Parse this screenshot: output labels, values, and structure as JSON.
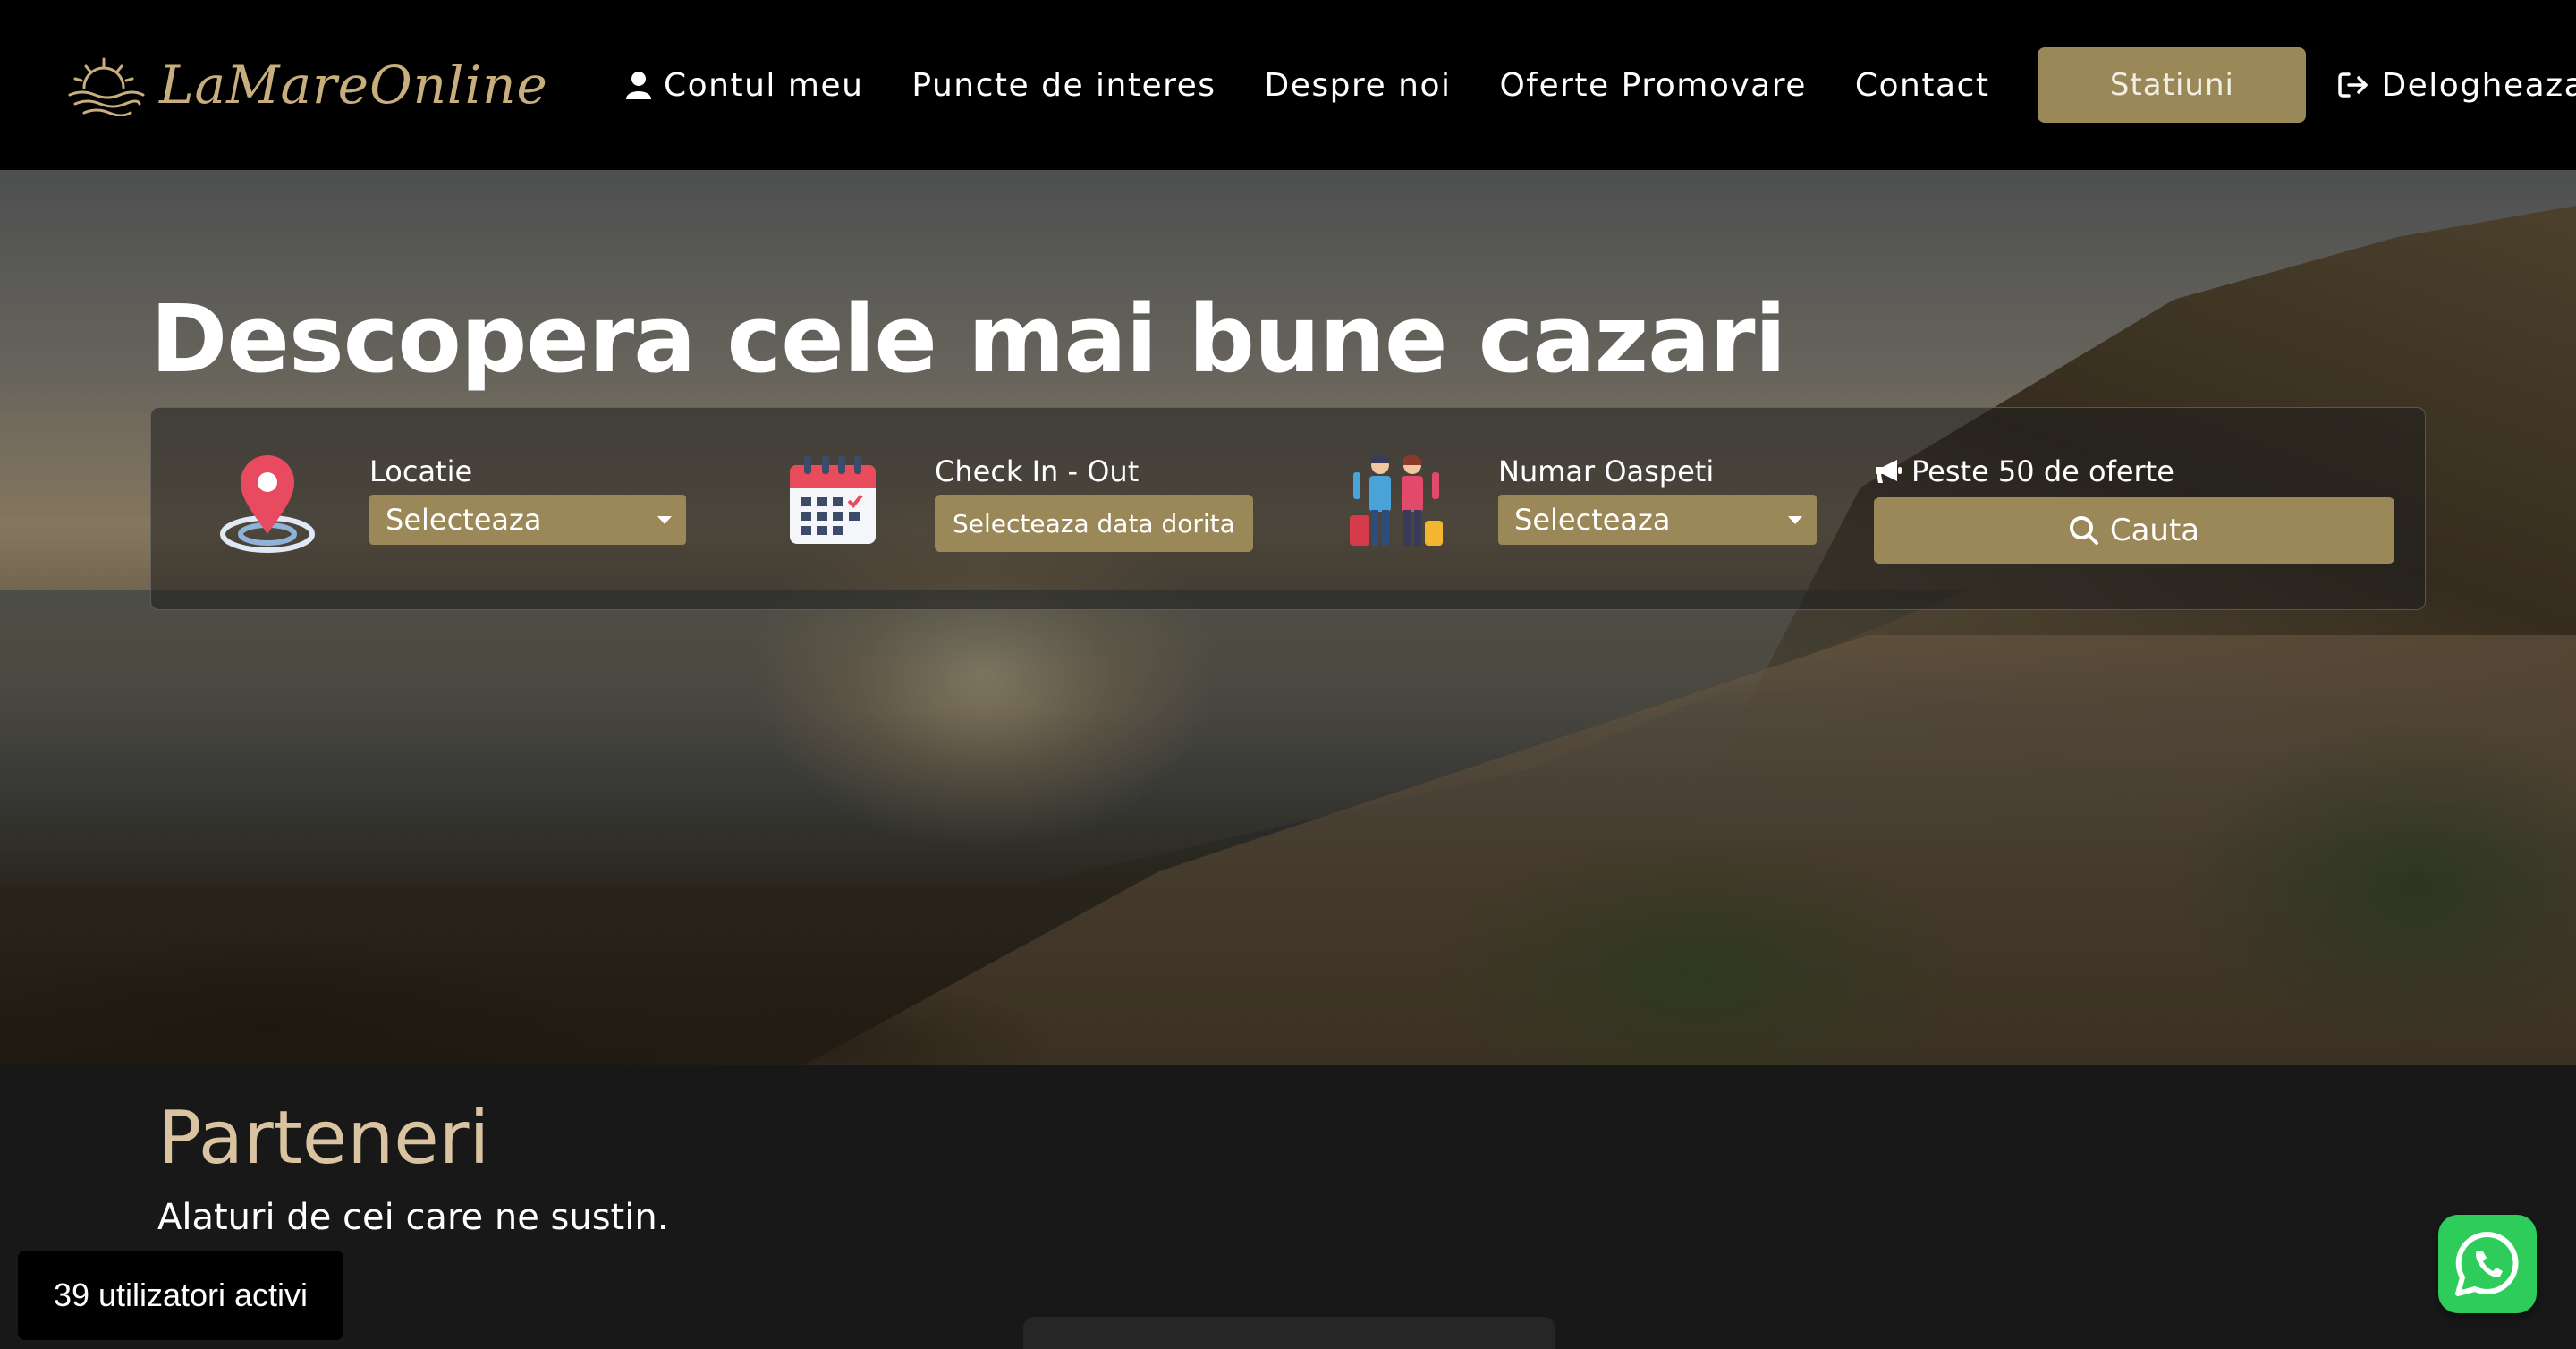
{
  "brand": {
    "name": "LaMareOnline"
  },
  "nav": {
    "account": "Contul meu",
    "poi": "Puncte de interes",
    "about": "Despre noi",
    "offers": "Oferte Promovare",
    "contact": "Contact",
    "stations": "Statiuni",
    "logout": "Delogheaza-te"
  },
  "hero": {
    "title": "Descopera cele mai bune cazari"
  },
  "search": {
    "location_label": "Locatie",
    "location_value": "Selecteaza",
    "checkin_label": "Check In - Out",
    "checkin_value": "Selecteaza data dorita",
    "guests_label": "Numar Oaspeti",
    "guests_value": "Selecteaza",
    "offers_label": "Peste 50 de oferte",
    "search_button": "Cauta"
  },
  "partners": {
    "title": "Parteneri",
    "subtitle": "Alaturi de cei care ne sustin."
  },
  "widgets": {
    "active_users": "39 utilizatori activi"
  },
  "colors": {
    "accent": "#9b8859",
    "gold_text": "#c8ae7d",
    "partners_title": "#d9c3a0",
    "whatsapp": "#2ecc5b"
  },
  "icons": {
    "user": "user-icon",
    "logout": "sign-out-icon",
    "location": "map-pin-icon",
    "calendar": "calendar-icon",
    "guests": "travelers-icon",
    "megaphone": "bullhorn-icon",
    "search": "search-icon",
    "whatsapp": "whatsapp-icon"
  }
}
